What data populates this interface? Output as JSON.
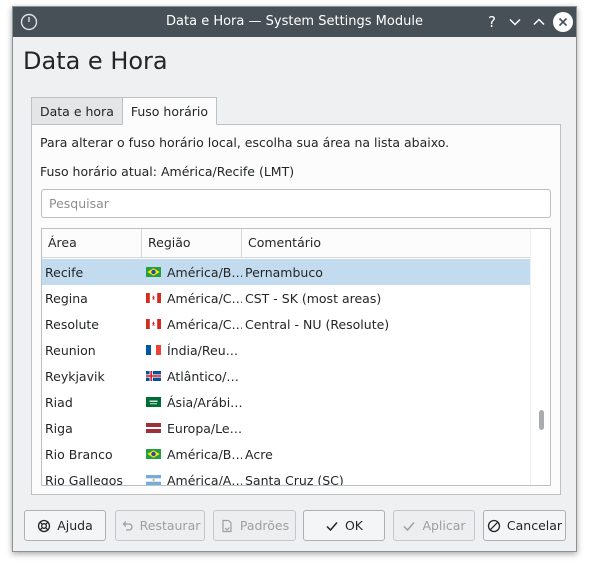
{
  "window": {
    "title": "Data e Hora — System Settings Module",
    "controls": {
      "help": "?",
      "minimize": "chevron-down-icon",
      "maximize": "chevron-up-icon",
      "close": "close-icon"
    }
  },
  "page": {
    "heading": "Data e Hora"
  },
  "tabs": [
    {
      "label": "Data e hora",
      "active": false
    },
    {
      "label": "Fuso horário",
      "active": true
    }
  ],
  "panel": {
    "instruction": "Para alterar o fuso horário local, escolha sua área na lista abaixo.",
    "current_timezone": "Fuso horário atual: América/Recife (LMT)",
    "search": {
      "placeholder": "Pesquisar",
      "value": ""
    }
  },
  "table": {
    "columns": [
      "Área",
      "Região",
      "Comentário"
    ],
    "rows": [
      {
        "area": "Recife",
        "flag": "brazil",
        "region": "América/B…",
        "comment": "Pernambuco",
        "selected": true
      },
      {
        "area": "Regina",
        "flag": "canada",
        "region": "América/C…",
        "comment": "CST - SK (most areas)",
        "selected": false
      },
      {
        "area": "Resolute",
        "flag": "canada",
        "region": "América/C…",
        "comment": "Central - NU (Resolute)",
        "selected": false
      },
      {
        "area": "Reunion",
        "flag": "france",
        "region": "Índia/Reu…",
        "comment": "",
        "selected": false
      },
      {
        "area": "Reykjavik",
        "flag": "iceland",
        "region": "Atlântico/…",
        "comment": "",
        "selected": false
      },
      {
        "area": "Riad",
        "flag": "saudi-arabia",
        "region": "Ásia/Arábi…",
        "comment": "",
        "selected": false
      },
      {
        "area": "Riga",
        "flag": "latvia",
        "region": "Europa/Le…",
        "comment": "",
        "selected": false
      },
      {
        "area": "Rio Branco",
        "flag": "brazil",
        "region": "América/B…",
        "comment": "Acre",
        "selected": false
      },
      {
        "area": "Rio Gallegos",
        "flag": "argentina",
        "region": "América/A…",
        "comment": "Santa Cruz (SC)",
        "selected": false
      }
    ]
  },
  "buttons": {
    "help": {
      "label": "Ajuda",
      "icon": "lifebuoy-icon",
      "enabled": true
    },
    "reset": {
      "label": "Restaurar",
      "icon": "undo-icon",
      "enabled": false
    },
    "defaults": {
      "label": "Padrões",
      "icon": "document-revert-icon",
      "enabled": false
    },
    "ok": {
      "label": "OK",
      "icon": "checkmark-icon",
      "enabled": true
    },
    "apply": {
      "label": "Aplicar",
      "icon": "checkmark-icon",
      "enabled": false
    },
    "cancel": {
      "label": "Cancelar",
      "icon": "cancel-icon",
      "enabled": true
    }
  },
  "colors": {
    "titlebar": "#475057",
    "selection": "#c3dbee",
    "window_bg": "#eff0f1"
  }
}
